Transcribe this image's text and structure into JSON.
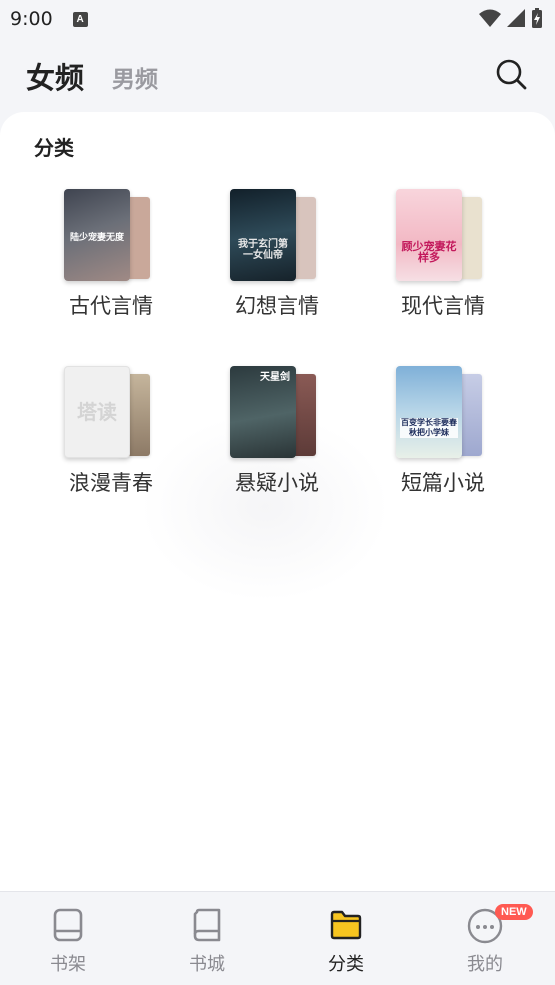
{
  "status_bar": {
    "time": "9:00",
    "notif_letter": "A"
  },
  "header": {
    "tab_female": "女频",
    "tab_male": "男频"
  },
  "section": {
    "title": "分类"
  },
  "categories": [
    {
      "label": "古代言情",
      "cover_title": "陆少宠妻无度",
      "front_color": "#5a5f6a",
      "back_color": "#c9a89a"
    },
    {
      "label": "幻想言情",
      "cover_title": "我于玄门第一女仙帝",
      "front_color": "#1d2a30",
      "back_color": "#d8c4bd"
    },
    {
      "label": "现代言情",
      "cover_title": "顾少宠妻花样多",
      "front_color": "#f3c7cf",
      "back_color": "#e9e1cf"
    },
    {
      "label": "浪漫青春",
      "cover_title": "塔读",
      "front_color": "#eeeeee",
      "back_color": "#b9a58c"
    },
    {
      "label": "悬疑小说",
      "cover_title": "天星剑",
      "front_color": "#3a4a4e",
      "back_color": "#7a5450"
    },
    {
      "label": "短篇小说",
      "cover_title": "百变学长非要春秋把小学妹",
      "front_color": "#9fc4d8",
      "back_color": "#c7cde6"
    }
  ],
  "tabbar": {
    "items": [
      {
        "label": "书架",
        "active": false
      },
      {
        "label": "书城",
        "active": false
      },
      {
        "label": "分类",
        "active": true
      },
      {
        "label": "我的",
        "active": false
      }
    ],
    "badge": "NEW"
  },
  "colors": {
    "accent": "#f7c520",
    "badge": "#ff5a52",
    "inactive": "#8a8a90"
  }
}
